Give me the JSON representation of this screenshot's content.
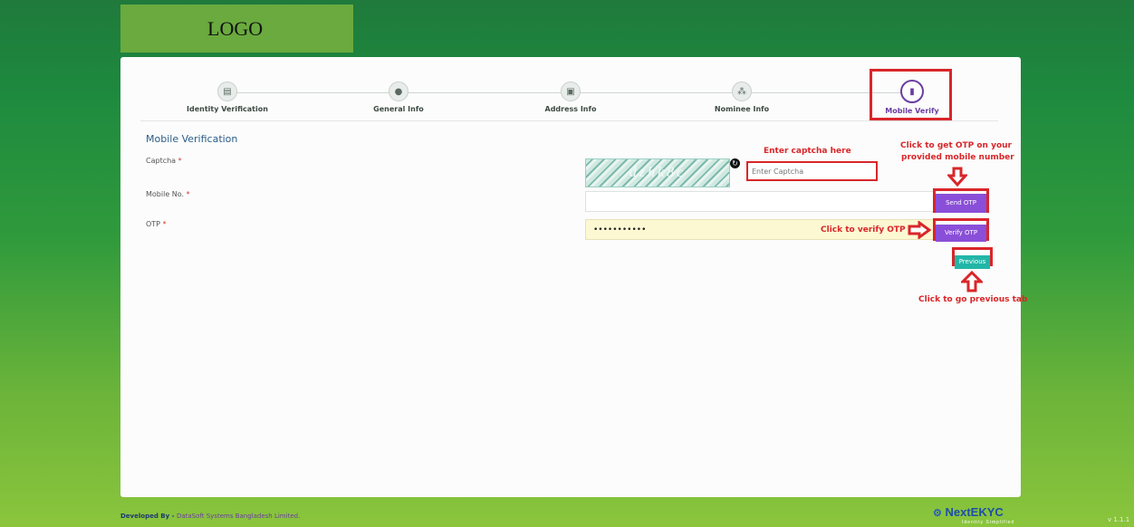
{
  "header": {
    "logo_text": "LOGO"
  },
  "stepper": {
    "steps": [
      {
        "label": "Identity Verification",
        "icon": "id-card-icon"
      },
      {
        "label": "General Info",
        "icon": "user-icon"
      },
      {
        "label": "Address Info",
        "icon": "address-card-icon"
      },
      {
        "label": "Nominee Info",
        "icon": "users-icon"
      },
      {
        "label": "Mobile Verify",
        "icon": "mobile-icon"
      }
    ],
    "active": "Mobile Verify"
  },
  "form": {
    "title": "Mobile Verification",
    "captcha_label": "Captcha",
    "captcha_text": "dzhk8c",
    "captcha_placeholder": "Enter Captcha",
    "mobile_label": "Mobile No.",
    "mobile_value": "",
    "otp_label": "OTP",
    "otp_value": "•••••••••••",
    "required_mark": "*"
  },
  "buttons": {
    "send_otp": "Send OTP",
    "verify_otp": "Verify OTP",
    "previous": "Previous"
  },
  "annotations": {
    "captcha": "Enter captcha here",
    "send_otp_1": "Click to get OTP on your",
    "send_otp_2": "provided mobile number",
    "verify": "Click to verify OTP",
    "previous": "Click to go previous tab"
  },
  "footer": {
    "developed_by": "Developed By - ",
    "company": "DataSoft Systems Bangladesh Limited.",
    "brand": "NextEKYC",
    "brand_tagline": "Identity Simplified",
    "version": "v 1.1.1"
  },
  "colors": {
    "accent_purple": "#8a4fd8",
    "teal": "#22b6a8",
    "annotation_red": "#d9262a",
    "logo_green": "#6aaa3e"
  }
}
